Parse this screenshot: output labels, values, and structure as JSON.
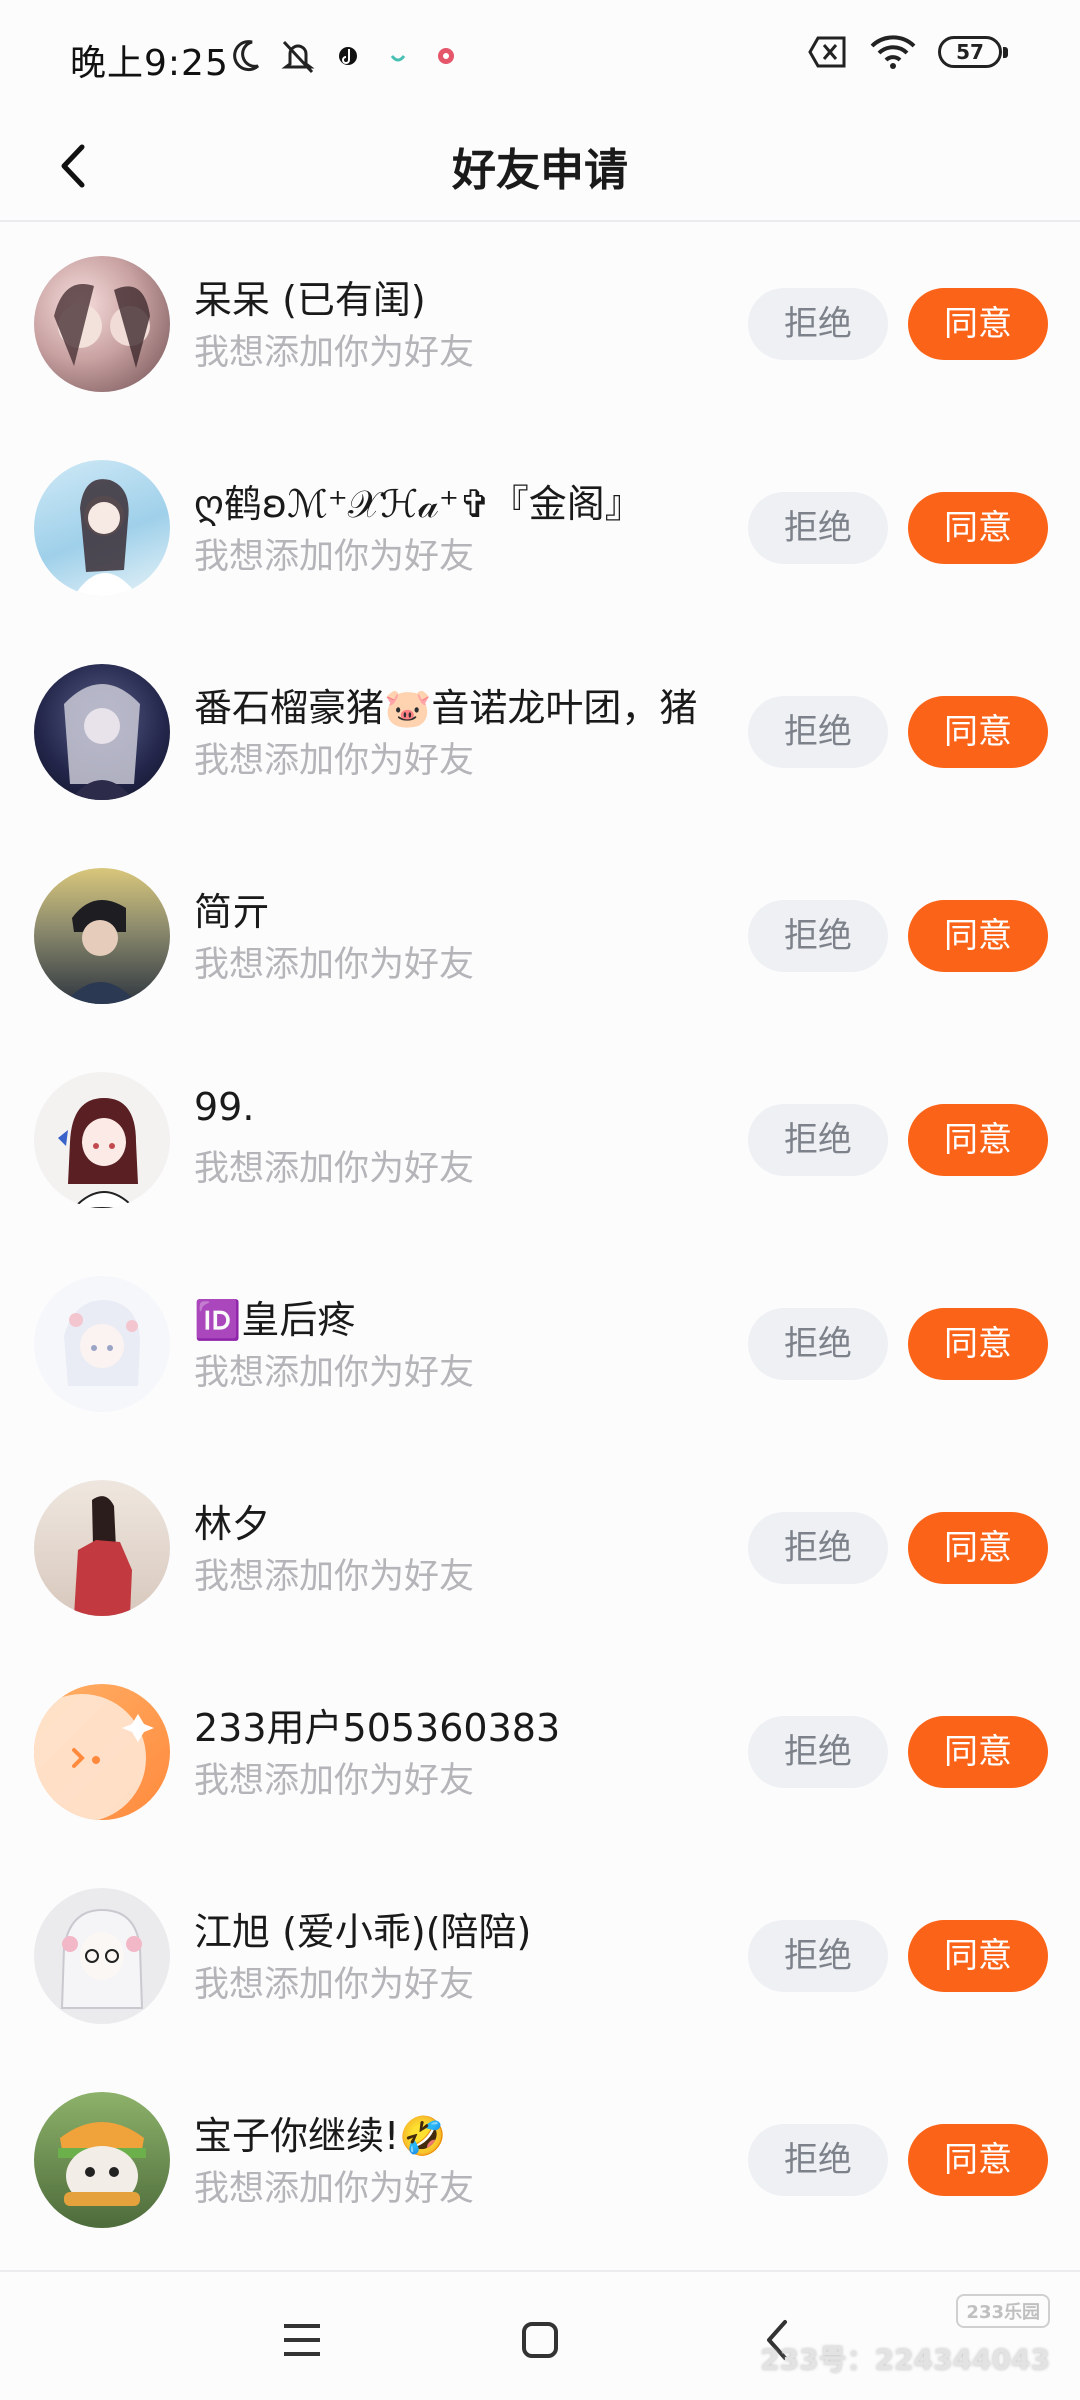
{
  "status_bar": {
    "time": "晚上9:25",
    "battery": "57",
    "icons": [
      "moon-icon",
      "silent-bell-icon",
      "tiktok-icon",
      "app-notify-icon",
      "app-notify-icon-2",
      "no-sim-icon",
      "wifi-icon",
      "battery-icon"
    ]
  },
  "header": {
    "title": "好友申请",
    "back_icon": "chevron-left-icon"
  },
  "requests": [
    {
      "name": "呆呆 (已有闺)",
      "message": "我想添加你为好友",
      "reject_label": "拒绝",
      "accept_label": "同意"
    },
    {
      "name": "ღ鹤ʚℳ⁺𝒳ℋ𝒶⁺✞『金阁』",
      "message": "我想添加你为好友",
      "reject_label": "拒绝",
      "accept_label": "同意"
    },
    {
      "name": "番石榴豪猪🐷音诺龙叶团，猪",
      "message": "我想添加你为好友",
      "reject_label": "拒绝",
      "accept_label": "同意"
    },
    {
      "name": "简亓",
      "message": "我想添加你为好友",
      "reject_label": "拒绝",
      "accept_label": "同意"
    },
    {
      "name": "99.",
      "message": "我想添加你为好友",
      "reject_label": "拒绝",
      "accept_label": "同意"
    },
    {
      "name": "🆔皇后疼",
      "message": "我想添加你为好友",
      "reject_label": "拒绝",
      "accept_label": "同意"
    },
    {
      "name": "林夕",
      "message": "我想添加你为好友",
      "reject_label": "拒绝",
      "accept_label": "同意"
    },
    {
      "name": "233用户505360383",
      "message": "我想添加你为好友",
      "reject_label": "拒绝",
      "accept_label": "同意"
    },
    {
      "name": "江旭 (爱小乖)(陪陪)",
      "message": "我想添加你为好友",
      "reject_label": "拒绝",
      "accept_label": "同意"
    },
    {
      "name": "宝子你继续!🤣",
      "message": "我想添加你为好友",
      "reject_label": "拒绝",
      "accept_label": "同意"
    }
  ],
  "nav_bar": {
    "icons": [
      "menu-icon",
      "home-icon",
      "back-icon"
    ]
  },
  "watermark": {
    "logo": "233乐园",
    "text": "233号：224344043"
  },
  "colors": {
    "accent": "#fb6418",
    "reject_bg": "#eef0f4",
    "subtitle": "#b4b4b9"
  }
}
